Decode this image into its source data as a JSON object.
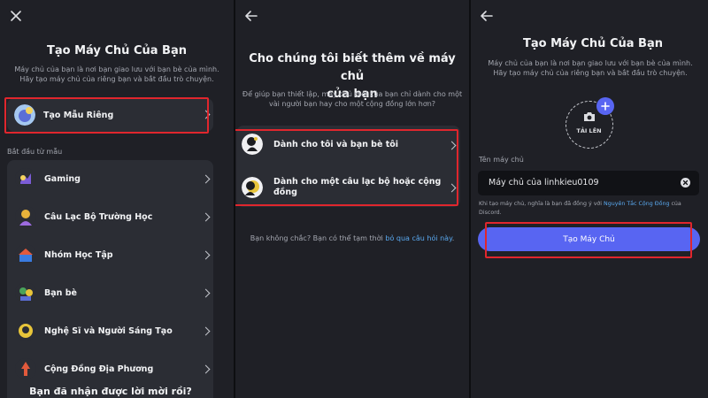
{
  "panel1": {
    "close_label": "✕",
    "title": "Tạo Máy Chủ Của Bạn",
    "subtitle_line1": "Máy chủ của bạn là nơi bạn giao lưu với bạn bè của mình.",
    "subtitle_line2": "Hãy tạo máy chủ của riêng bạn và bắt đầu trò chuyện.",
    "custom_label": "Tạo Mẫu Riêng",
    "section_label": "Bắt đầu từ mẫu",
    "templates": [
      {
        "label": "Gaming",
        "color": "#7b5cd6"
      },
      {
        "label": "Câu Lạc Bộ Trường Học",
        "color": "#e8b23a"
      },
      {
        "label": "Nhóm Học Tập",
        "color": "#3a7be0"
      },
      {
        "label": "Bạn bè",
        "color": "#4aa35b"
      },
      {
        "label": "Nghệ Sĩ và Người Sáng Tạo",
        "color": "#e8c53a"
      },
      {
        "label": "Cộng Đồng Địa Phương",
        "color": "#e25a3c"
      }
    ],
    "bottom_text": "Bạn đã nhận được lời mời rồi?"
  },
  "panel2": {
    "title_line1": "Cho chúng tôi biết thêm về máy chủ",
    "title_line2": "của bạn",
    "subtitle_line1": "Để giúp bạn thiết lập, máy chủ mới của bạn chỉ dành cho một",
    "subtitle_line2": "vài người bạn hay cho một cộng đồng lớn hơn?",
    "option1": "Dành cho tôi và bạn bè tôi",
    "option2_line1": "Dành cho một câu lạc bộ hoặc cộng",
    "option2_line2": "đồng",
    "note_prefix": "Bạn không chắc? Bạn có thể tạm thời ",
    "note_link": "bỏ qua câu hỏi này",
    "note_suffix": "."
  },
  "panel3": {
    "title": "Tạo Máy Chủ Của Bạn",
    "subtitle_line1": "Máy chủ của bạn là nơi bạn giao lưu với bạn bè của mình.",
    "subtitle_line2": "Hãy tạo máy chủ của riêng bạn và bắt đầu trò chuyện.",
    "upload_label": "TẢI LÊN",
    "field_label": "Tên máy chủ",
    "field_value": "Máy chủ của linhkieu0109",
    "terms_prefix": "Khi tạo máy chủ, nghĩa là bạn đã đồng ý với ",
    "terms_link": "Nguyên Tắc Cộng Đồng",
    "terms_suffix": " của",
    "terms_line2": "Discord.",
    "create_button": "Tạo Máy Chủ"
  },
  "colors": {
    "accent": "#5865f2",
    "highlight": "#e0262d",
    "link": "#5aa9f0"
  }
}
